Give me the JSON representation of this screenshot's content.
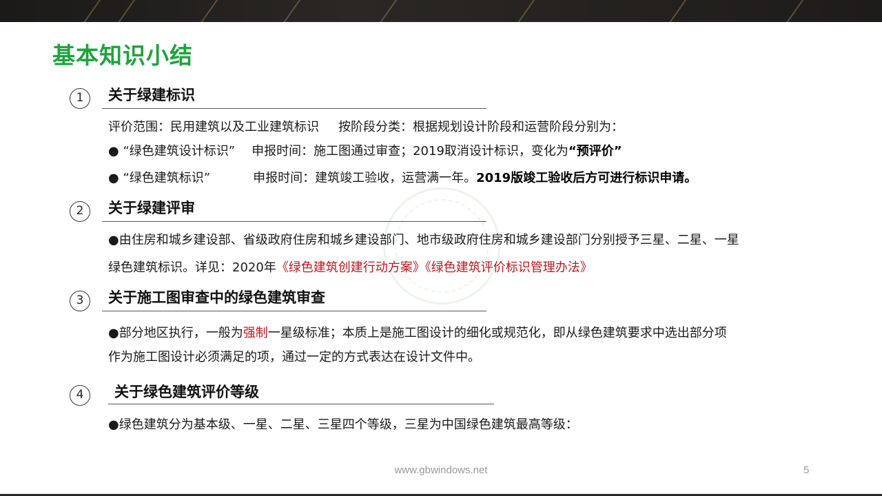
{
  "title": "基本知识小结",
  "sections": [
    {
      "number": "1",
      "heading": "关于绿建标识",
      "scope": "评价范围：民用建筑以及工业建筑标识",
      "stage": "按阶段分类：根据规划设计阶段和运营阶段分别为：",
      "bullet1": {
        "dot": "●",
        "name": "“绿色建筑设计标识”",
        "time": "申报时间：施工图通过审查；2019取消设计标识，变化为",
        "highlight": "“预评价”"
      },
      "bullet2": {
        "dot": "●",
        "name": "“绿色建筑标识”",
        "time": "申报时间：建筑竣工验收，运营满一年。",
        "highlight": "2019版竣工验收后方可进行标识申请。"
      }
    },
    {
      "number": "2",
      "heading": "关于绿建评审",
      "line1": "●由住房和城乡建设部、省级政府住房和城乡建设部门、地市级政府住房和城乡建设部门分别授予三星、二星、一星",
      "line2_prefix": "绿色建筑标识。详见：2020年",
      "line2_docs": "《绿色建筑创建行动方案》《绿色建筑评价标识管理办法》"
    },
    {
      "number": "3",
      "heading": "关于施工图审查中的绿色建筑审查",
      "line1_prefix": "●部分地区执行，一般为",
      "line1_red": "强制",
      "line1_suffix": "一星级标准；本质上是施工图设计的细化或规范化，即从绿色建筑要求中选出部分项",
      "line2": "作为施工图设计必须满足的项，通过一定的方式表达在设计文件中。"
    },
    {
      "number": "4",
      "heading": "关于绿色建筑评价等级",
      "line1": "●绿色建筑分为基本级、一星、二星、三星四个等级，三星为中国绿色建筑最高等级："
    }
  ],
  "footer": {
    "url": "www.gbwindows.net",
    "page": "5"
  },
  "colors": {
    "title": "#1ca53c",
    "highlight_red": "#c0181e",
    "band": "#1b1a18"
  }
}
